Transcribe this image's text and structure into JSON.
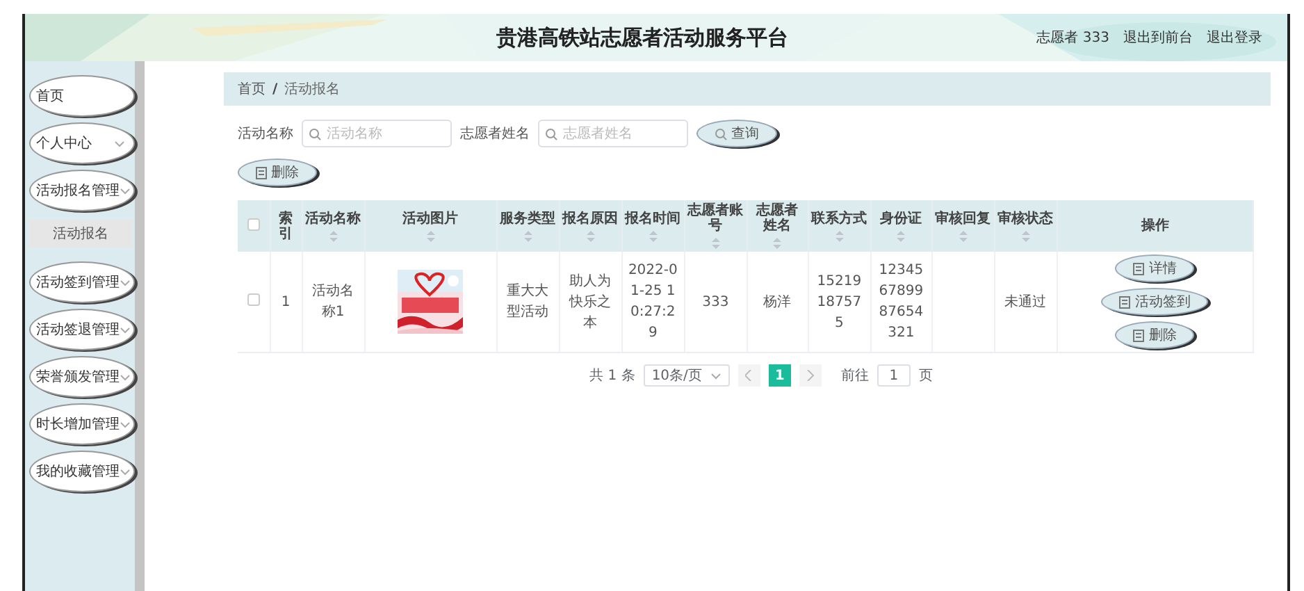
{
  "header": {
    "title": "贵港高铁站志愿者活动服务平台",
    "user": "志愿者 333",
    "links": [
      "退出到前台",
      "退出登录"
    ]
  },
  "sidebar": {
    "items": [
      {
        "label": "首页",
        "kind": "link"
      },
      {
        "label": "个人中心",
        "kind": "menu"
      },
      {
        "label": "活动报名管理",
        "kind": "menu",
        "children": [
          {
            "label": "活动报名",
            "selected": true
          }
        ]
      },
      {
        "label": "活动签到管理",
        "kind": "menu"
      },
      {
        "label": "活动签退管理",
        "kind": "menu"
      },
      {
        "label": "荣誉颁发管理",
        "kind": "menu"
      },
      {
        "label": "时长增加管理",
        "kind": "menu"
      },
      {
        "label": "我的收藏管理",
        "kind": "menu"
      }
    ]
  },
  "breadcrumb": {
    "items": [
      "首页",
      "活动报名"
    ],
    "separator": "/"
  },
  "search": {
    "fields": [
      {
        "label": "活动名称",
        "placeholder": "活动名称"
      },
      {
        "label": "志愿者姓名",
        "placeholder": "志愿者姓名"
      }
    ],
    "button": "查询"
  },
  "toolbar": {
    "buttons": [
      "删除"
    ]
  },
  "table": {
    "select_all_checked": false,
    "columns": [
      {
        "label": "索引",
        "sortable": false
      },
      {
        "label": "活动名称",
        "sortable": true
      },
      {
        "label": "活动图片",
        "sortable": true
      },
      {
        "label": "服务类型",
        "sortable": true
      },
      {
        "label": "报名原因",
        "sortable": true
      },
      {
        "label": "报名时间",
        "sortable": true
      },
      {
        "label": "志愿者账号",
        "sortable": true
      },
      {
        "label": "志愿者姓名",
        "sortable": true
      },
      {
        "label": "联系方式",
        "sortable": true
      },
      {
        "label": "身份证",
        "sortable": true
      },
      {
        "label": "审核回复",
        "sortable": true
      },
      {
        "label": "审核状态",
        "sortable": true
      },
      {
        "label": "操作",
        "sortable": false
      }
    ],
    "rows": [
      {
        "checked": false,
        "cells": [
          "1",
          "活动名称1",
          {
            "kind": "picture"
          },
          "重大大型活动",
          "助人为快乐之本",
          "2022-01-25 10:27:29",
          "333",
          "杨洋",
          "15219187575",
          "123456789987654321",
          "",
          "未通过"
        ],
        "actions": [
          "详情",
          "活动签到",
          "删除"
        ]
      }
    ]
  },
  "pagination": {
    "total": "共 1 条",
    "page_size": "10条/页",
    "pages": [
      {
        "label": "1",
        "selected": true
      }
    ],
    "goto_label": "前往",
    "goto_value": "1",
    "goto_suffix": "页"
  }
}
